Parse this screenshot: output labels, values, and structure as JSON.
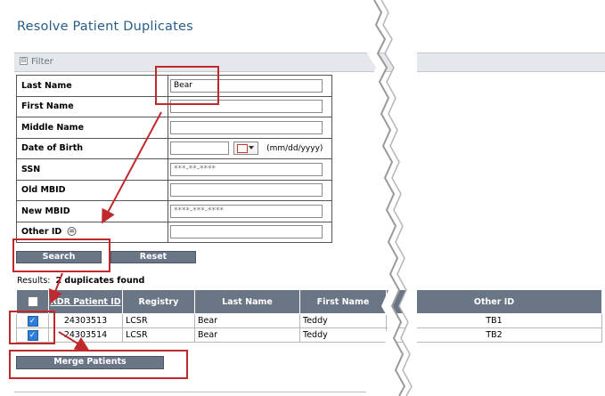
{
  "page": {
    "title": "Resolve Patient Duplicates"
  },
  "filter": {
    "label": "Filter",
    "toggle": "⊟"
  },
  "form": {
    "rows": [
      {
        "label": "Last Name",
        "value": "Bear",
        "placeholder": ""
      },
      {
        "label": "First Name",
        "value": "",
        "placeholder": ""
      },
      {
        "label": "Middle Name",
        "value": "",
        "placeholder": ""
      },
      {
        "label": "Date of Birth",
        "value": "",
        "placeholder": "",
        "hint": "(mm/dd/yyyy)"
      },
      {
        "label": "SSN",
        "value": "",
        "placeholder": "***-**-****"
      },
      {
        "label": "Old MBID",
        "value": "",
        "placeholder": ""
      },
      {
        "label": "New MBID",
        "value": "",
        "placeholder": "****-***-****"
      },
      {
        "label": "Other ID",
        "value": "",
        "placeholder": ""
      }
    ]
  },
  "buttons": {
    "search": "Search",
    "reset": "Reset",
    "merge": "Merge Patients"
  },
  "results": {
    "label": "Results:",
    "summary": "2 duplicates found",
    "columns": [
      "",
      "RDR Patient ID",
      "Registry",
      "Last Name",
      "First Name",
      "Other ID"
    ],
    "rows": [
      {
        "checked": true,
        "rdr_id": "24303513",
        "registry": "LCSR",
        "last_name": "Bear",
        "first_name": "Teddy",
        "other_id": "TB1"
      },
      {
        "checked": true,
        "rdr_id": "24303514",
        "registry": "LCSR",
        "last_name": "Bear",
        "first_name": "Teddy",
        "other_id": "TB2"
      }
    ]
  },
  "colors": {
    "accent": "#2a5d86",
    "header_bg": "#6a7686",
    "annotation": "#c0292b",
    "checkbox": "#2f7ed8"
  }
}
